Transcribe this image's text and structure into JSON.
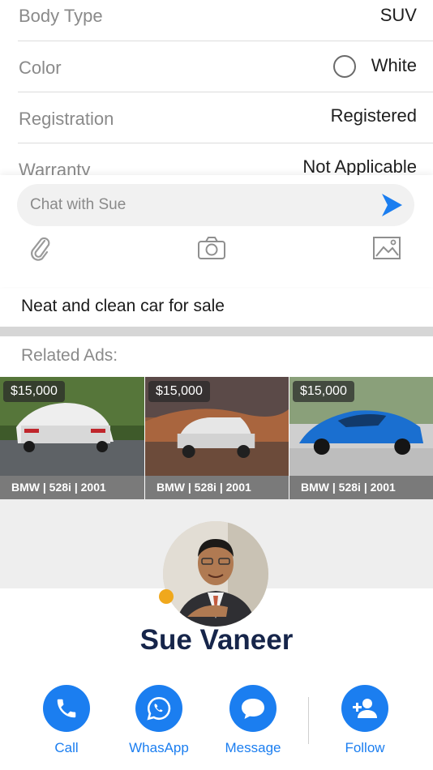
{
  "specs": [
    {
      "label": "Body Type",
      "value": "SUV"
    },
    {
      "label": "Color",
      "value": "White"
    },
    {
      "label": "Registration",
      "value": "Registered"
    },
    {
      "label": "Warranty",
      "value": "Not Applicable"
    }
  ],
  "chat": {
    "placeholder": "Chat with Sue",
    "send_icon": "send-arrow-icon",
    "attach_icon": "paperclip-icon",
    "camera_icon": "camera-icon",
    "image_icon": "image-icon"
  },
  "description": "Neat and clean car for sale",
  "related": {
    "title": "Related Ads:",
    "ads": [
      {
        "price": "$15,000",
        "title": "BMW | 528i | 2001"
      },
      {
        "price": "$15,000",
        "title": "BMW | 528i | 2001"
      },
      {
        "price": "$15,000",
        "title": "BMW | 528i | 2001"
      }
    ]
  },
  "seller": {
    "name": "Sue Vaneer",
    "status_color": "#f0a81c"
  },
  "actions": {
    "call": "Call",
    "whatsapp": "WhasApp",
    "message": "Message",
    "follow": "Follow"
  },
  "colors": {
    "accent": "#1b7ef0",
    "name": "#16254a"
  }
}
